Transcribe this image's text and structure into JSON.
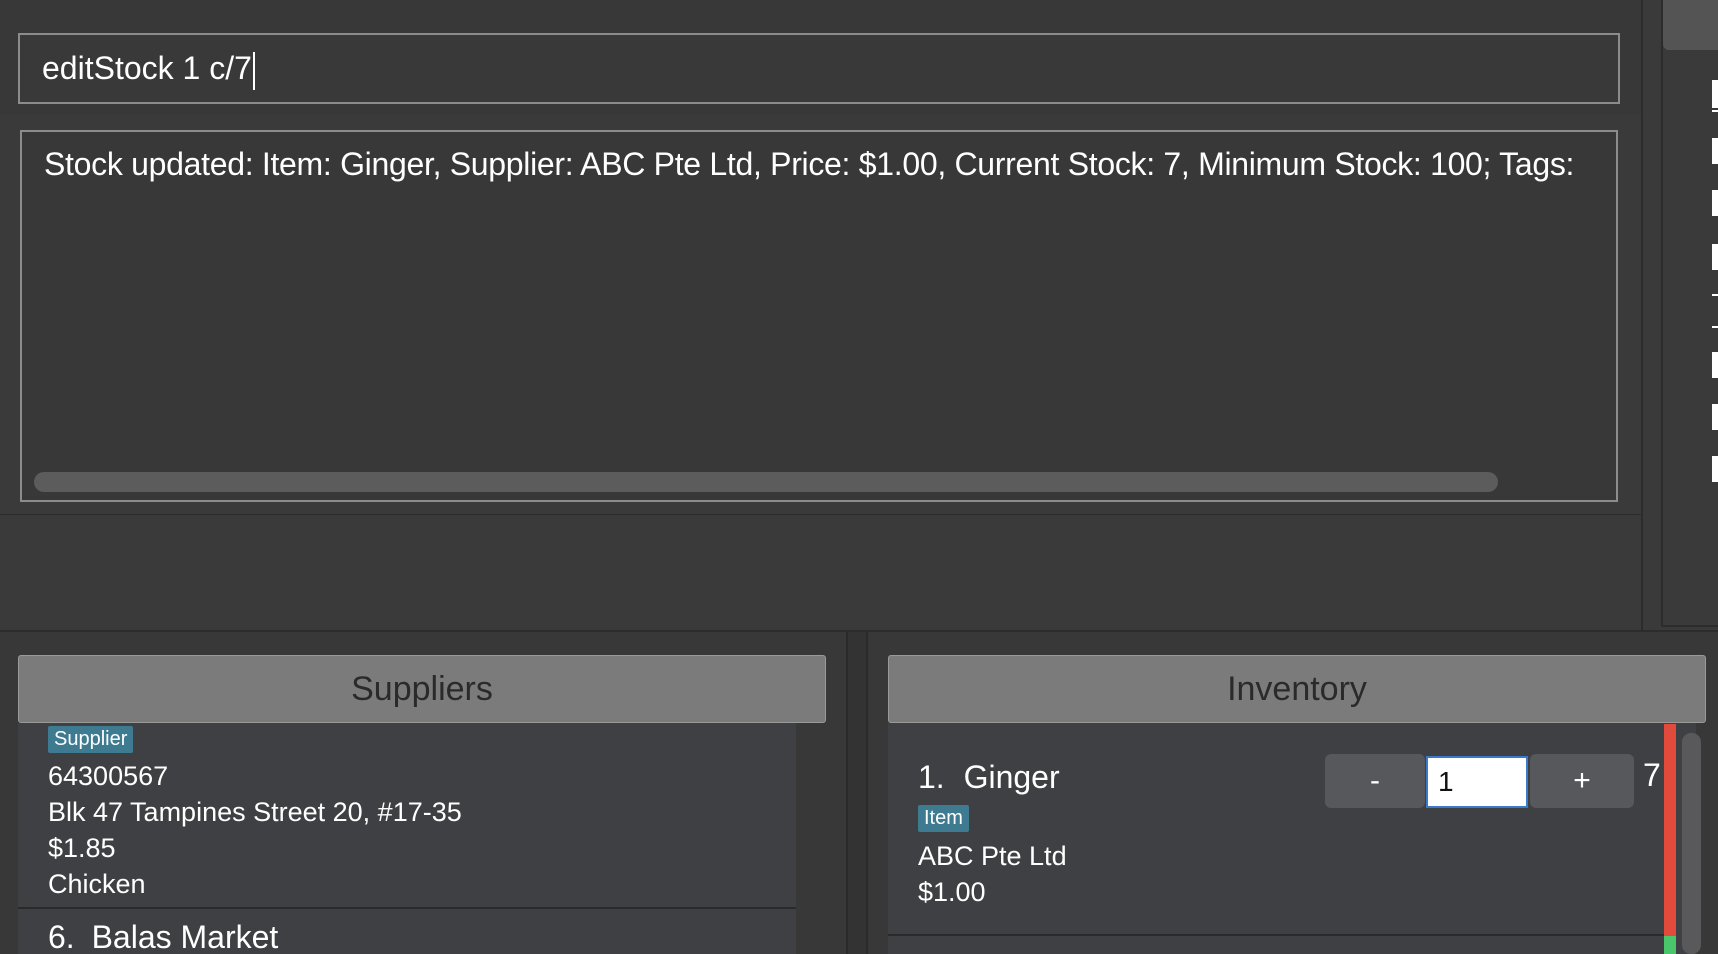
{
  "command_box": {
    "value": "editStock 1 c/7"
  },
  "result_display": {
    "text": "Stock updated: Item: Ginger, Supplier: ABC Pte Ltd, Price: $1.00, Current Stock: 7, Minimum Stock: 100; Tags:"
  },
  "suppliers_panel": {
    "title": "Suppliers",
    "visible_card": {
      "tag": "Supplier",
      "phone": "64300567",
      "address": "Blk 47 Tampines Street 20, #17-35",
      "price": "$1.85",
      "item": "Chicken"
    },
    "next_card": {
      "index": "6.",
      "name": "Balas Market"
    }
  },
  "inventory_panel": {
    "title": "Inventory",
    "items": [
      {
        "index": "1.",
        "name": "Ginger",
        "tag": "Item",
        "supplier": "ABC Pte Ltd",
        "price": "$1.00",
        "stepper": {
          "decrement_label": "-",
          "quantity": "1",
          "increment_label": "+"
        },
        "current_stock": "7"
      }
    ]
  },
  "colors": {
    "background": "#3a3a3a",
    "header": "#7b7b7b",
    "tag": "#3e7b91",
    "low_stock": "#e24a3b",
    "ok_stock": "#4bc76b"
  }
}
